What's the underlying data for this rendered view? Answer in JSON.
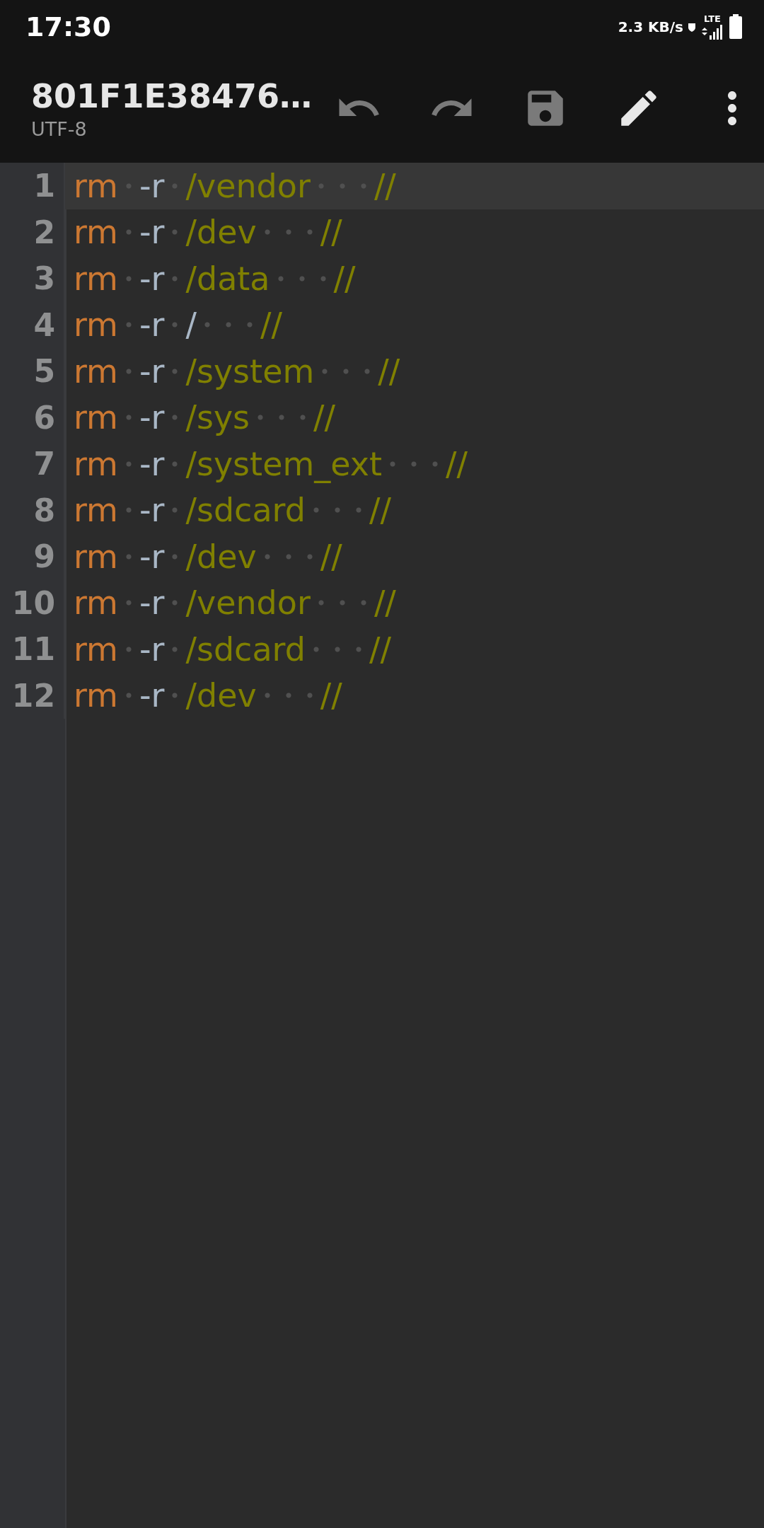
{
  "status_bar": {
    "time": "17:30",
    "speed": "2.3 KB/s",
    "network": "LTE"
  },
  "toolbar": {
    "title": "801F1E38476…",
    "encoding": "UTF-8",
    "actions": [
      {
        "kind": "undo",
        "disabled": true
      },
      {
        "kind": "redo",
        "disabled": true
      },
      {
        "kind": "save",
        "disabled": true
      },
      {
        "kind": "edit",
        "disabled": false
      },
      {
        "kind": "more",
        "disabled": false
      }
    ]
  },
  "editor": {
    "lines": [
      {
        "number": "1",
        "current": true,
        "tokens": [
          {
            "kind": "command",
            "text": "rm"
          },
          {
            "kind": "flag",
            "text": "-r"
          },
          {
            "kind": "path",
            "text": "/vendor"
          },
          {
            "kind": "comment",
            "text": "//"
          }
        ]
      },
      {
        "number": "2",
        "current": false,
        "tokens": [
          {
            "kind": "command",
            "text": "rm"
          },
          {
            "kind": "flag",
            "text": "-r"
          },
          {
            "kind": "path",
            "text": "/dev"
          },
          {
            "kind": "comment",
            "text": "//"
          }
        ]
      },
      {
        "number": "3",
        "current": false,
        "tokens": [
          {
            "kind": "command",
            "text": "rm"
          },
          {
            "kind": "flag",
            "text": "-r"
          },
          {
            "kind": "path",
            "text": "/data"
          },
          {
            "kind": "comment",
            "text": "//"
          }
        ]
      },
      {
        "number": "4",
        "current": false,
        "tokens": [
          {
            "kind": "command",
            "text": "rm"
          },
          {
            "kind": "flag",
            "text": "-r"
          },
          {
            "kind": "flag",
            "text": "/"
          },
          {
            "kind": "comment",
            "text": "//"
          }
        ]
      },
      {
        "number": "5",
        "current": false,
        "tokens": [
          {
            "kind": "command",
            "text": "rm"
          },
          {
            "kind": "flag",
            "text": "-r"
          },
          {
            "kind": "path",
            "text": "/system"
          },
          {
            "kind": "comment",
            "text": "//"
          }
        ]
      },
      {
        "number": "6",
        "current": false,
        "tokens": [
          {
            "kind": "command",
            "text": "rm"
          },
          {
            "kind": "flag",
            "text": "-r"
          },
          {
            "kind": "path",
            "text": "/sys"
          },
          {
            "kind": "comment",
            "text": "//"
          }
        ]
      },
      {
        "number": "7",
        "current": false,
        "tokens": [
          {
            "kind": "command",
            "text": "rm"
          },
          {
            "kind": "flag",
            "text": "-r"
          },
          {
            "kind": "path",
            "text": "/system_ext"
          },
          {
            "kind": "comment",
            "text": "//"
          }
        ]
      },
      {
        "number": "8",
        "current": false,
        "tokens": [
          {
            "kind": "command",
            "text": "rm"
          },
          {
            "kind": "flag",
            "text": "-r"
          },
          {
            "kind": "path",
            "text": "/sdcard"
          },
          {
            "kind": "comment",
            "text": "//"
          }
        ]
      },
      {
        "number": "9",
        "current": false,
        "tokens": [
          {
            "kind": "command",
            "text": "rm"
          },
          {
            "kind": "flag",
            "text": "-r"
          },
          {
            "kind": "path",
            "text": "/dev"
          },
          {
            "kind": "comment",
            "text": "//"
          }
        ]
      },
      {
        "number": "10",
        "current": false,
        "tokens": [
          {
            "kind": "command",
            "text": "rm"
          },
          {
            "kind": "flag",
            "text": "-r"
          },
          {
            "kind": "path",
            "text": "/vendor"
          },
          {
            "kind": "comment",
            "text": "//"
          }
        ]
      },
      {
        "number": "11",
        "current": false,
        "tokens": [
          {
            "kind": "command",
            "text": "rm"
          },
          {
            "kind": "flag",
            "text": "-r"
          },
          {
            "kind": "path",
            "text": "/sdcard"
          },
          {
            "kind": "comment",
            "text": "//"
          }
        ]
      },
      {
        "number": "12",
        "current": false,
        "tokens": [
          {
            "kind": "command",
            "text": "rm"
          },
          {
            "kind": "flag",
            "text": "-r"
          },
          {
            "kind": "path",
            "text": "/dev"
          },
          {
            "kind": "comment",
            "text": "//"
          }
        ]
      }
    ]
  }
}
